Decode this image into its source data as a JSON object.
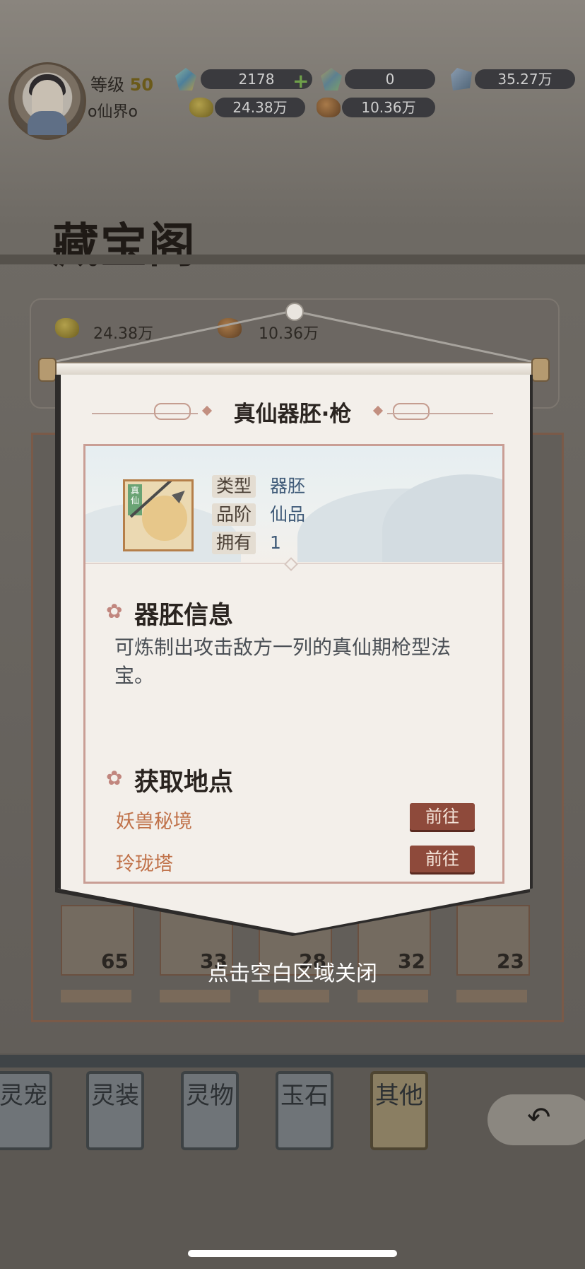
{
  "player": {
    "level_label": "等级",
    "level_value": "50",
    "name": "o仙界o"
  },
  "currencies": {
    "gem_green": "2178",
    "gem_blue": "0",
    "crystal": "35.27万",
    "gold_ore": "24.38万",
    "copper_ore": "10.36万"
  },
  "shop": {
    "title": "藏宝阁",
    "gold_ore": "24.38万",
    "copper_ore": "10.36万",
    "item_counts": [
      "65",
      "33",
      "28",
      "32",
      "23"
    ]
  },
  "tabs": [
    {
      "label": "灵宠"
    },
    {
      "label": "灵装"
    },
    {
      "label": "灵物"
    },
    {
      "label": "玉石"
    },
    {
      "label": "其他",
      "selected": true
    }
  ],
  "modal": {
    "item_name": "真仙器胚·枪",
    "icon_tag": "真仙",
    "attributes": [
      {
        "label": "类型",
        "value": "器胚"
      },
      {
        "label": "品阶",
        "value": "仙品"
      },
      {
        "label": "拥有",
        "value": "1"
      }
    ],
    "info_title": "器胚信息",
    "info_desc": "可炼制出攻击敌方一列的真仙期枪型法宝。",
    "source_title": "获取地点",
    "sources": [
      {
        "name": "妖兽秘境",
        "button": "前往"
      },
      {
        "name": "玲珑塔",
        "button": "前往"
      }
    ]
  },
  "close_hint": "点击空白区域关闭",
  "colors": {
    "scroll_bg": "#f3efea",
    "accent_brown": "#8e4a3b",
    "source_text": "#c0724a",
    "value_blue": "#3f5a78"
  }
}
